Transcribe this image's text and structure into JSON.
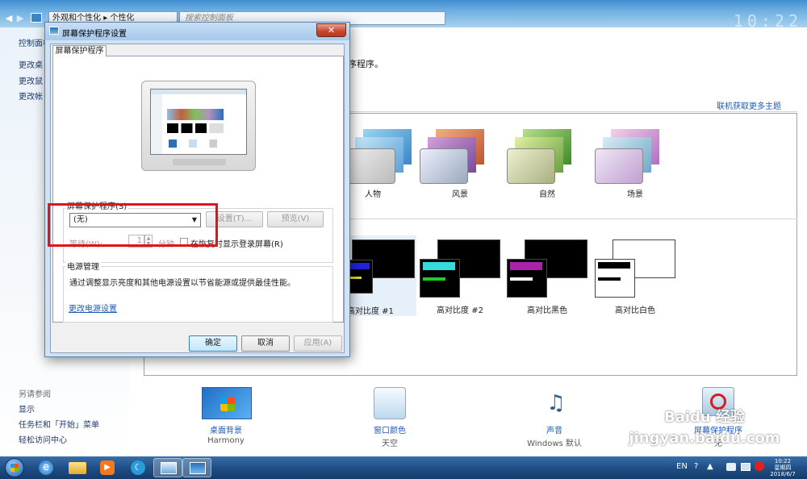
{
  "control_panel": {
    "breadcrumb": [
      "外观和个性化",
      "个性化"
    ],
    "search_placeholder": "搜索控制面板",
    "sidebar": {
      "home": "控制面板",
      "links": [
        "更改桌",
        "更改鼠",
        "更改帐"
      ],
      "see_also_title": "另请参阅",
      "see_also": [
        "显示",
        "任务栏和「开始」菜单",
        "轻松访问中心"
      ]
    },
    "intro_text": "序程序。",
    "online_link": "联机获取更多主题",
    "themes": [
      {
        "label": "人物",
        "color": "#66aadd"
      },
      {
        "label": "风景",
        "color": "#cc6644"
      },
      {
        "label": "自然",
        "color": "#77bb44"
      },
      {
        "label": "场景",
        "color": "#bb88cc"
      }
    ],
    "high_contrast": [
      {
        "label": "高对比度 #1",
        "accent": "#2222dd"
      },
      {
        "label": "高对比度 #2",
        "accent": "#33dddd"
      },
      {
        "label": "高对比黑色",
        "accent": "#aa22aa"
      },
      {
        "label": "高对比白色",
        "accent": "#000000"
      }
    ],
    "bottom_bar": [
      {
        "label": "桌面背景",
        "sub": "Harmony"
      },
      {
        "label": "窗口颜色",
        "sub": "天空"
      },
      {
        "label": "声音",
        "sub": "Windows 默认"
      },
      {
        "label": "屏幕保护程序",
        "sub": "无"
      }
    ]
  },
  "dialog": {
    "title": "屏幕保护程序设置",
    "close_glyph": "✕",
    "tab": "屏幕保护程序",
    "group_ss_label": "屏幕保护程序(S)",
    "selected": "(无)",
    "settings_btn": "设置(T)...",
    "preview_btn": "预览(V)",
    "wait_label": "等待(W):",
    "wait_value": "1",
    "minutes_label": "分钟",
    "resume_label": "在恢复时显示登录屏幕(R)",
    "power_group_label": "电源管理",
    "power_text": "通过调整显示亮度和其他电源设置以节省能源或提供最佳性能。",
    "power_link": "更改电源设置",
    "ok_btn": "确定",
    "cancel_btn": "取消",
    "apply_btn": "应用(A)"
  },
  "taskbar": {
    "lang": "EN",
    "time": "10:22",
    "day": "星期四",
    "date": "2018/6/7"
  },
  "watermark": "Baidu 经验 jingyan.baidu.com"
}
